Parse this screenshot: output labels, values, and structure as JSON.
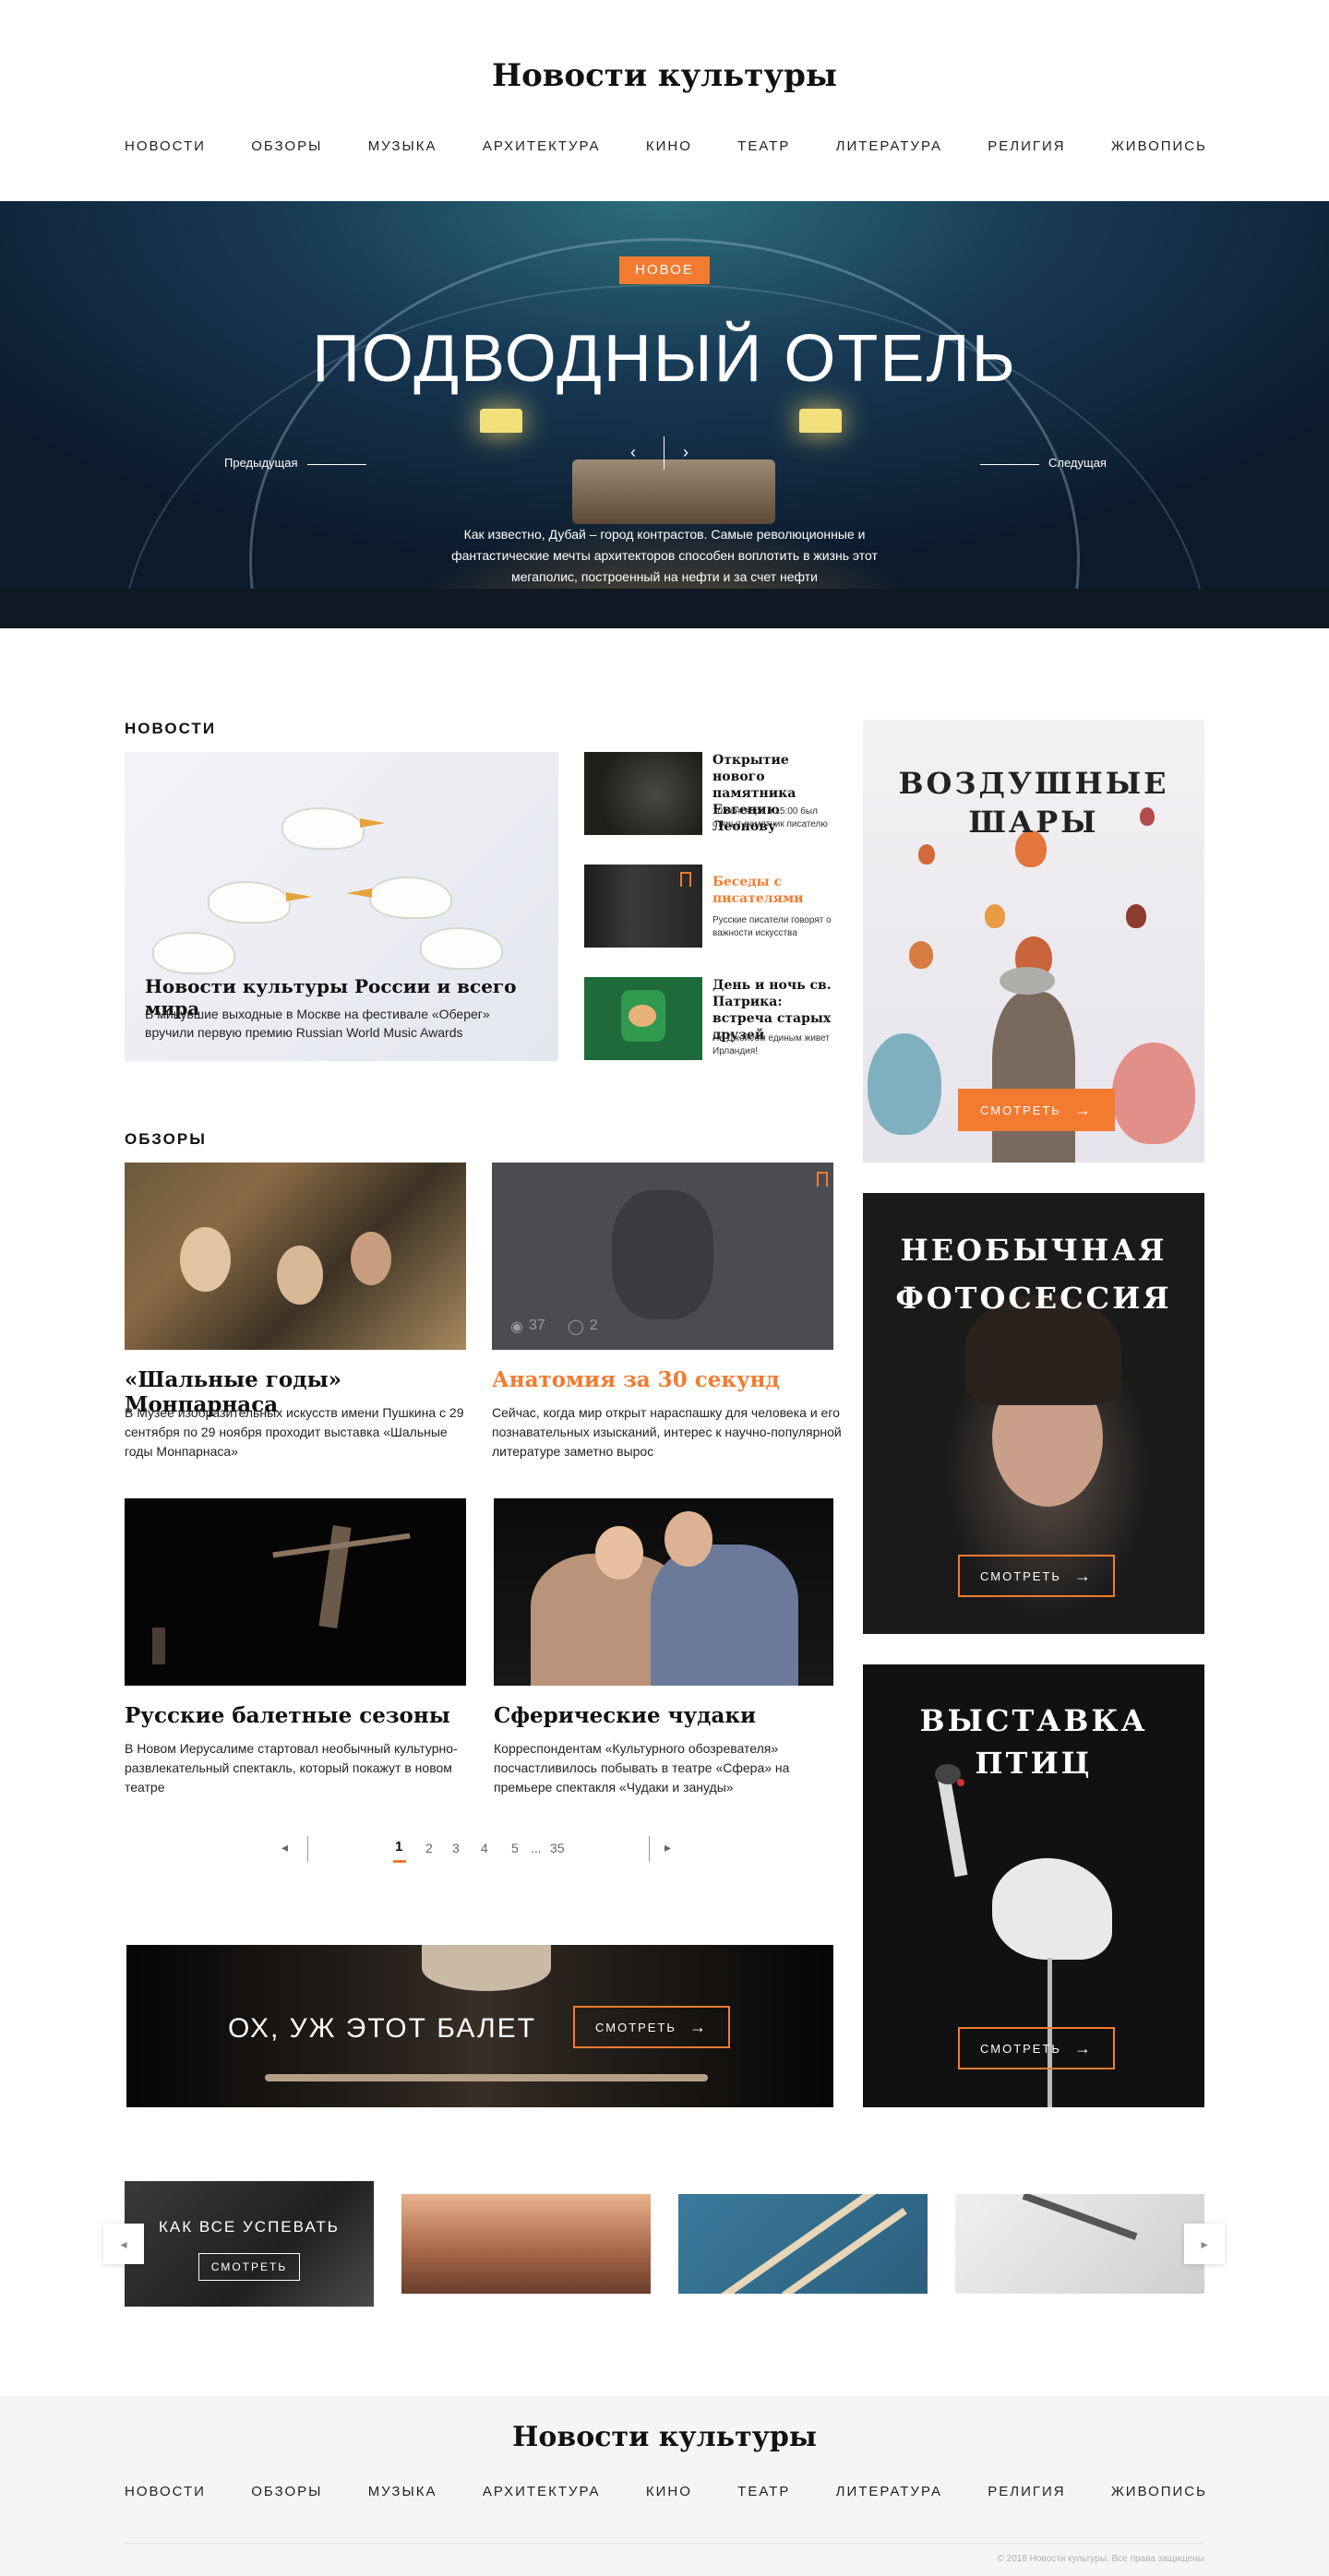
{
  "header": {
    "title": "Новости культуры",
    "nav": [
      "НОВОСТИ",
      "ОБЗОРЫ",
      "МУЗЫКА",
      "АРХИТЕКТУРА",
      "КИНО",
      "ТЕАТР",
      "ЛИТЕРАТУРА",
      "РЕЛИГИЯ",
      "ЖИВОПИСЬ"
    ]
  },
  "hero": {
    "badge": "НОВОЕ",
    "title": "ПОДВОДНЫЙ ОТЕЛЬ",
    "prev": "Предыдущая",
    "next": "Следущая",
    "arrow_left": "‹",
    "arrow_right": "›",
    "description": "Как известно, Дубай – город контрастов. Самые революционные и фантастические мечты архитекторов способен воплотить в жизнь этот мегаполис, построенный на нефти и за счет нефти"
  },
  "news": {
    "label": "НОВОСТИ",
    "main": {
      "title": "Новости культуры России и всего мира",
      "text": "В минувшие выходные в Москве на фестивале «Оберег» вручили первую премию Russian World Music Awards"
    },
    "items": [
      {
        "title": "Открытие нового памятника Евгению Леонову",
        "text": "10 сентября в 15:00 был открыт памятник писателю"
      },
      {
        "title": "Беседы с писателями",
        "text": "Русские писатели говорят о важности искусства"
      },
      {
        "title": "День и ночь св. Патрика: встреча старых друзей",
        "text": "Не Джойсом единым живет Ирландия!"
      }
    ]
  },
  "reviews": {
    "label": "ОБЗОРЫ",
    "items": [
      {
        "title": "«Шальные годы» Монпарнаса",
        "text": "В Музее изобразительных искусств имени Пушкина с 29 сентября по 29 ноября проходит выставка «Шальные годы Монпарнаса»"
      },
      {
        "title": "Анатомия за 30 секунд",
        "text": "Сейчас, когда мир открыт нараспашку для человека и его познавательных изысканий, интерес к научно-популярной литературе заметно вырос",
        "views": "37",
        "comments": "2"
      },
      {
        "title": "Русские балетные сезоны",
        "text": "В Новом Иерусалиме стартовал необычный культурно-развлекательный спектакль, который покажут в новом театре"
      },
      {
        "title": "Сферические чудаки",
        "text": "Корреспондентам «Культурного обозревателя» посчастливилось побывать в театре «Сфера» на премьере спектакля «Чудаки и зануды»"
      }
    ]
  },
  "pagination": {
    "pages": [
      "1",
      "2",
      "3",
      "4",
      "5"
    ],
    "ellipsis": "...",
    "last": "35",
    "prev": "◂",
    "next": "▸"
  },
  "promos": [
    {
      "title": "ВОЗДУШНЫЕ ШАРЫ",
      "button": "СМОТРЕТЬ"
    },
    {
      "title": "НЕОБЫЧНАЯ ФОТОСЕССИЯ",
      "button": "СМОТРЕТЬ"
    },
    {
      "title": "ВЫСТАВКА ПТИЦ",
      "button": "СМОТРЕТЬ"
    }
  ],
  "banner": {
    "title": "ОХ, УЖ ЭТОТ БАЛЕТ",
    "button": "СМОТРЕТЬ"
  },
  "carousel": {
    "first_title": "КАК ВСЕ УСПЕВАТЬ",
    "first_button": "СМОТРЕТЬ",
    "prev": "◂",
    "next": "▸"
  },
  "footer": {
    "title": "Новости культуры",
    "nav": [
      "НОВОСТИ",
      "ОБЗОРЫ",
      "МУЗЫКА",
      "АРХИТЕКТУРА",
      "КИНО",
      "ТЕАТР",
      "ЛИТЕРАТУРА",
      "РЕЛИГИЯ",
      "ЖИВОПИСЬ"
    ],
    "copyright": "© 2018 Новости культуры. Все права защищены"
  },
  "colors": {
    "accent": "#f37b30",
    "dark": "#111111",
    "footer_bg": "#f5f5f5"
  },
  "icons": {
    "arrow": "→",
    "bookmark": "bookmark-icon",
    "eye": "eye-icon",
    "comment": "comment-icon"
  }
}
